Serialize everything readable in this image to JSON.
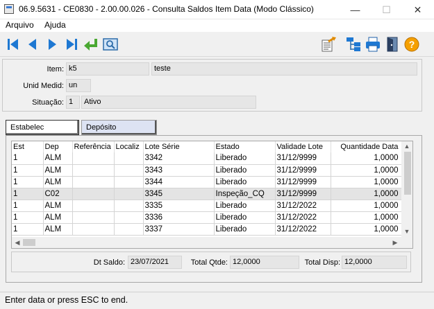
{
  "window": {
    "title": "06.9.5631 - CE0830 - 2.00.00.026 - Consulta Saldos Item Data (Modo Clássico)",
    "minimize_glyph": "—",
    "maximize_glyph": "☐",
    "close_glyph": "✕"
  },
  "menu": {
    "items": [
      {
        "label": "Arquivo"
      },
      {
        "label": "Ajuda"
      }
    ]
  },
  "toolbar": {
    "left_icons": [
      "first-record-icon",
      "previous-record-icon",
      "next-record-icon",
      "last-record-icon",
      "goto-icon",
      "search-icon"
    ],
    "right_icons": [
      "export-icon",
      "tree-icon",
      "print-icon",
      "exit-icon",
      "help-icon"
    ],
    "help_glyph": "?"
  },
  "header": {
    "item_label": "Item:",
    "item_code": "k5",
    "item_desc_blank": "",
    "item_desc": "teste",
    "unit_label": "Unid Medid:",
    "unit_value": "un",
    "status_label": "Situação:",
    "status_code": "1",
    "status_desc": "Ativo"
  },
  "tabs": [
    {
      "label": "Estabelec"
    },
    {
      "label": "Depósito"
    }
  ],
  "grid": {
    "columns": [
      "Est",
      "Dep",
      "Referência",
      "Localiz",
      "Lote Série",
      "Estado",
      "Validade Lote",
      "Quantidade Data"
    ],
    "rows": [
      [
        "1",
        "ALM",
        "",
        "",
        "3342",
        "Liberado",
        "31/12/9999",
        "1,0000"
      ],
      [
        "1",
        "ALM",
        "",
        "",
        "3343",
        "Liberado",
        "31/12/9999",
        "1,0000"
      ],
      [
        "1",
        "ALM",
        "",
        "",
        "3344",
        "Liberado",
        "31/12/9999",
        "1,0000"
      ],
      [
        "1",
        "C02",
        "",
        "",
        "3345",
        "Inspeção_CQ",
        "31/12/9999",
        "1,0000"
      ],
      [
        "1",
        "ALM",
        "",
        "",
        "3335",
        "Liberado",
        "31/12/2022",
        "1,0000"
      ],
      [
        "1",
        "ALM",
        "",
        "",
        "3336",
        "Liberado",
        "31/12/2022",
        "1,0000"
      ],
      [
        "1",
        "ALM",
        "",
        "",
        "3337",
        "Liberado",
        "31/12/2022",
        "1,0000"
      ]
    ],
    "selected_row": 3,
    "scroll_up_glyph": "▲",
    "scroll_down_glyph": "▼",
    "scroll_left_glyph": "◀",
    "scroll_right_glyph": "▶"
  },
  "footer": {
    "dt_saldo_label": "Dt Saldo:",
    "dt_saldo_value": "23/07/2021",
    "total_qtde_label": "Total Qtde:",
    "total_qtde_value": "12,0000",
    "total_disp_label": "Total Disp:",
    "total_disp_value": "12,0000"
  },
  "status_bar": {
    "text": "Enter data or press ESC to end."
  },
  "colors": {
    "nav_blue": "#1e78d2",
    "goto_green": "#4aa832",
    "help_orange": "#f5a000",
    "inactive_tab": "#dde3f3",
    "selected_row": "#e4e4e4"
  }
}
